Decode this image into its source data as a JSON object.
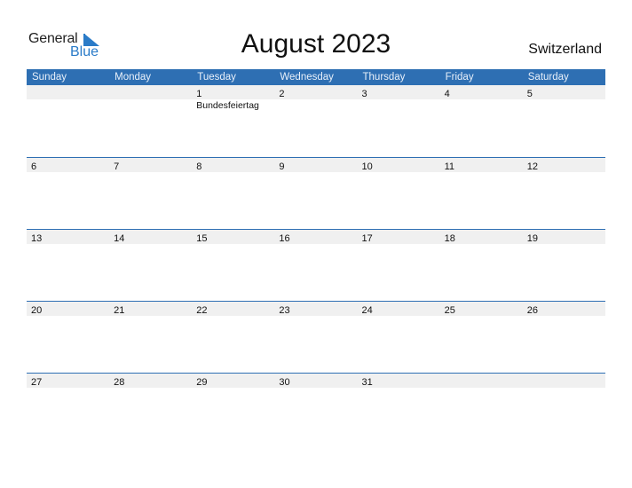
{
  "logo": {
    "general": "General",
    "blue": "Blue",
    "icon": "triangle-flag-icon",
    "accent": "#2a7bc8"
  },
  "title": "August 2023",
  "country": "Switzerland",
  "colors": {
    "header_bg": "#2e6fb3",
    "day_strip_bg": "#f0f0f0"
  },
  "weekdays": [
    "Sunday",
    "Monday",
    "Tuesday",
    "Wednesday",
    "Thursday",
    "Friday",
    "Saturday"
  ],
  "weeks": [
    [
      {
        "day": ""
      },
      {
        "day": ""
      },
      {
        "day": "1",
        "holiday": "Bundesfeiertag"
      },
      {
        "day": "2"
      },
      {
        "day": "3"
      },
      {
        "day": "4"
      },
      {
        "day": "5"
      }
    ],
    [
      {
        "day": "6"
      },
      {
        "day": "7"
      },
      {
        "day": "8"
      },
      {
        "day": "9"
      },
      {
        "day": "10"
      },
      {
        "day": "11"
      },
      {
        "day": "12"
      }
    ],
    [
      {
        "day": "13"
      },
      {
        "day": "14"
      },
      {
        "day": "15"
      },
      {
        "day": "16"
      },
      {
        "day": "17"
      },
      {
        "day": "18"
      },
      {
        "day": "19"
      }
    ],
    [
      {
        "day": "20"
      },
      {
        "day": "21"
      },
      {
        "day": "22"
      },
      {
        "day": "23"
      },
      {
        "day": "24"
      },
      {
        "day": "25"
      },
      {
        "day": "26"
      }
    ],
    [
      {
        "day": "27"
      },
      {
        "day": "28"
      },
      {
        "day": "29"
      },
      {
        "day": "30"
      },
      {
        "day": "31"
      },
      {
        "day": ""
      },
      {
        "day": ""
      }
    ]
  ]
}
